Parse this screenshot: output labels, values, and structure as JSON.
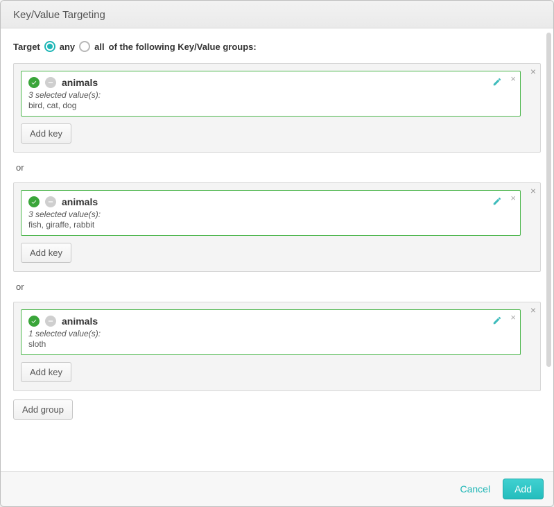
{
  "title": "Key/Value Targeting",
  "target": {
    "label": "Target",
    "radioSelected": "any",
    "optAny": "any",
    "optAll": "all",
    "suffix": " of the following Key/Value groups:"
  },
  "groups": [
    {
      "key": "animals",
      "selectedCountText": "3 selected value(s):",
      "values": "bird, cat, dog",
      "addKeyLabel": "Add key"
    },
    {
      "sepBefore": "or",
      "key": "animals",
      "selectedCountText": "3 selected value(s):",
      "values": "fish, giraffe, rabbit",
      "addKeyLabel": "Add key"
    },
    {
      "sepBefore": "or",
      "key": "animals",
      "selectedCountText": "1 selected value(s):",
      "values": "sloth",
      "addKeyLabel": "Add key"
    }
  ],
  "addGroupLabel": "Add group",
  "footer": {
    "cancel": "Cancel",
    "add": "Add"
  }
}
